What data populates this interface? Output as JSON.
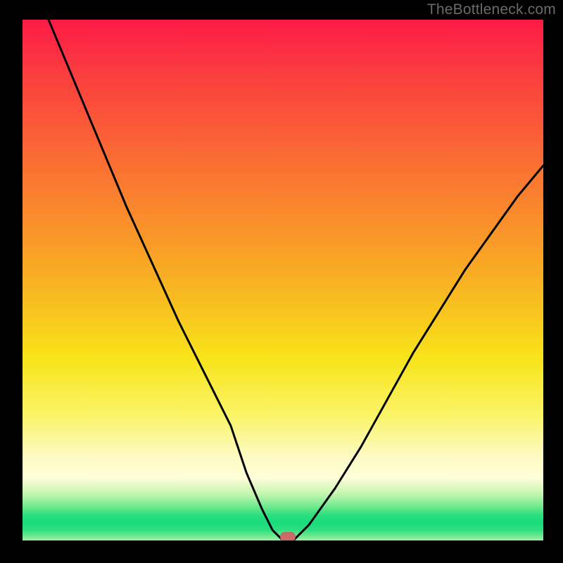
{
  "watermark": "TheBottleneck.com",
  "chart_data": {
    "type": "line",
    "title": "",
    "xlabel": "",
    "ylabel": "",
    "xlim": [
      0,
      100
    ],
    "ylim": [
      0,
      100
    ],
    "grid": false,
    "legend": false,
    "series": [
      {
        "name": "bottleneck-curve",
        "x": [
          5,
          10,
          15,
          20,
          25,
          30,
          35,
          40,
          43,
          46,
          48,
          50,
          52,
          55,
          60,
          65,
          70,
          75,
          80,
          85,
          90,
          95,
          100
        ],
        "y": [
          100,
          88,
          76,
          64,
          53,
          42,
          32,
          22,
          13,
          6,
          2,
          0,
          0,
          3,
          10,
          18,
          27,
          36,
          44,
          52,
          59,
          66,
          72
        ]
      }
    ],
    "marker": {
      "x": 51,
      "y": 0.7,
      "color": "#cc6a6a"
    },
    "background_gradient": {
      "stops": [
        {
          "pos": 0.0,
          "color": "#fc1b46"
        },
        {
          "pos": 0.26,
          "color": "#fa6a34"
        },
        {
          "pos": 0.55,
          "color": "#f8c11f"
        },
        {
          "pos": 0.76,
          "color": "#faf468"
        },
        {
          "pos": 0.88,
          "color": "#fefed8"
        },
        {
          "pos": 0.95,
          "color": "#17db7c"
        },
        {
          "pos": 1.0,
          "color": "#9df1a6"
        }
      ]
    }
  }
}
